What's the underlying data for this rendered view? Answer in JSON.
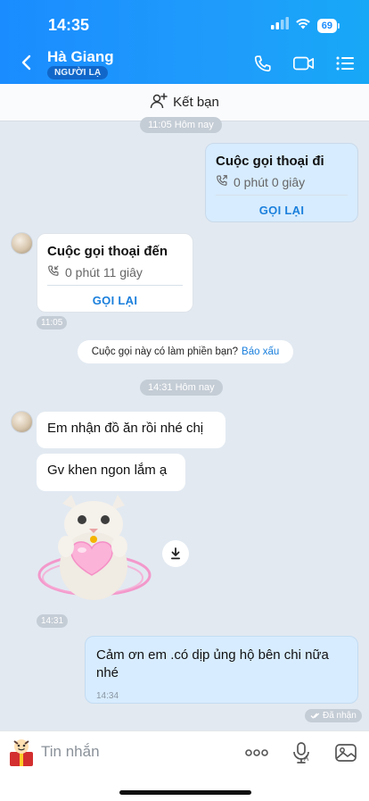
{
  "status_bar": {
    "time": "14:35",
    "battery": "69"
  },
  "header": {
    "name": "Hà Giang",
    "tag": "NGƯỜI LẠ"
  },
  "add_friend": {
    "label": "Kết bạn"
  },
  "messages": {
    "chip_top": "11:05 Hôm nay",
    "outgoing_call": {
      "title": "Cuộc gọi thoại đi",
      "duration": "0 phút 0 giây",
      "action": "GỌI LẠI"
    },
    "incoming_call": {
      "title": "Cuộc gọi thoại đến",
      "duration": "0 phút 11 giây",
      "action": "GỌI LẠI",
      "time": "11:05"
    },
    "prompt": {
      "text": "Cuộc gọi này có làm phiền bạn?",
      "link": "Báo xấu"
    },
    "chip_mid": "14:31 Hôm nay",
    "incoming_text_1": "Em nhận đồ ăn rồi nhé chị",
    "incoming_text_2": "Gv khen ngon lắm ạ",
    "sticker_time": "14:31",
    "outgoing_text": {
      "text": "Cảm ơn em .có dịp ủng hộ bên chi nữa nhé",
      "time": "14:34"
    },
    "seen": "Đã nhận"
  },
  "input": {
    "placeholder": "Tin nhắn"
  },
  "colors": {
    "header": "#1a8cff",
    "accent": "#1a7fdc",
    "chat_bg": "#e2e9f1",
    "outgoing_bubble": "#d7ecfe"
  }
}
